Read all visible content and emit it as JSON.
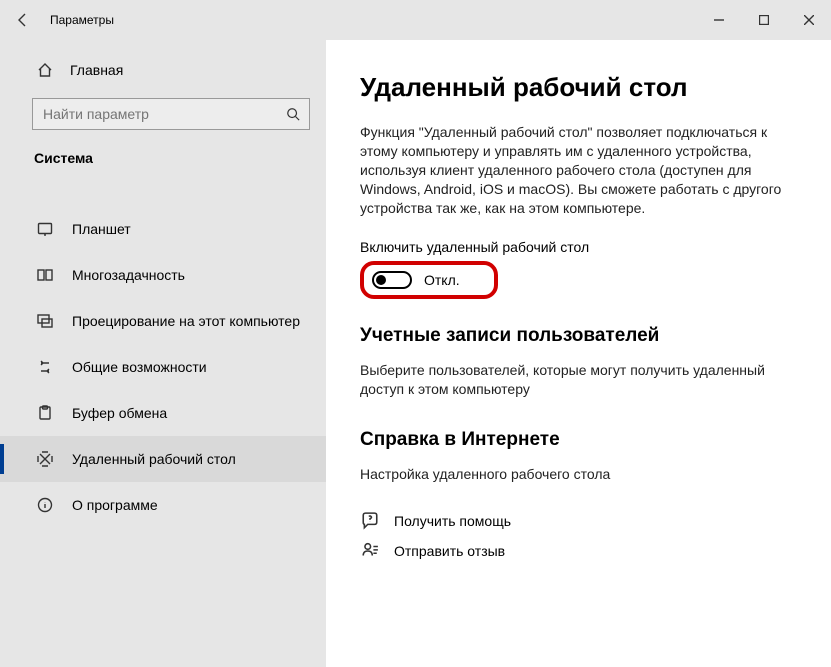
{
  "titlebar": {
    "title": "Параметры"
  },
  "sidebar": {
    "home": "Главная",
    "search_placeholder": "Найти параметр",
    "category": "Система",
    "items": [
      {
        "label": "Планшет"
      },
      {
        "label": "Многозадачность"
      },
      {
        "label": "Проецирование на этот компьютер"
      },
      {
        "label": "Общие возможности"
      },
      {
        "label": "Буфер обмена"
      },
      {
        "label": "Удаленный рабочий стол"
      },
      {
        "label": "О программе"
      }
    ]
  },
  "main": {
    "title": "Удаленный рабочий стол",
    "desc": "Функция \"Удаленный рабочий стол\" позволяет подключаться к этому компьютеру и управлять им с удаленного устройства, используя клиент удаленного рабочего стола (доступен для Windows, Android, iOS и macOS). Вы сможете работать с другого устройства так же, как на этом компьютере.",
    "toggle_label": "Включить удаленный рабочий стол",
    "toggle_state": "Откл.",
    "accounts_title": "Учетные записи пользователей",
    "accounts_desc": "Выберите пользователей, которые могут получить удаленный доступ к этом компьютеру",
    "help_title": "Справка в Интернете",
    "help_desc": "Настройка удаленного рабочего стола",
    "get_help": "Получить помощь",
    "feedback": "Отправить отзыв"
  }
}
